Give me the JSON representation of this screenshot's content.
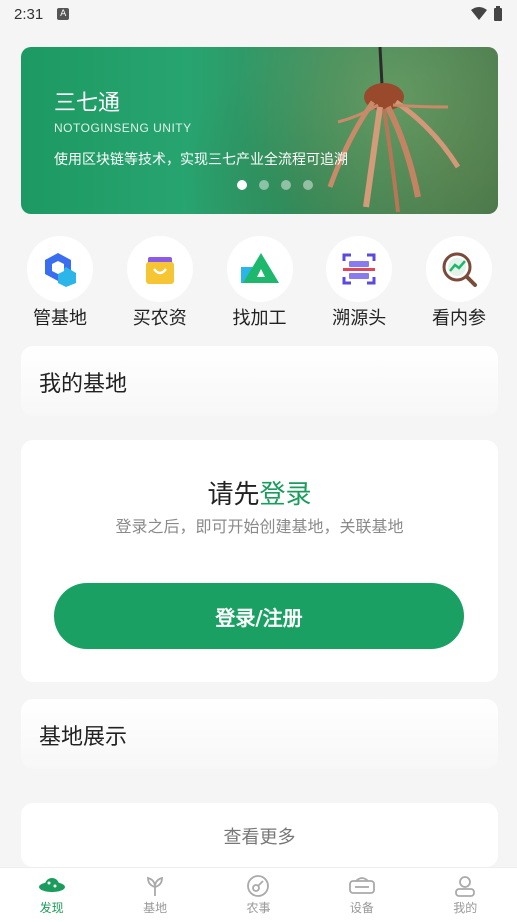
{
  "status_bar": {
    "time": "2:31",
    "notification": "A"
  },
  "banner": {
    "title": "三七通",
    "subtitle": "NOTOGINSENG UNITY",
    "description": "使用区块链等技术，实现三七产业全流程可追溯",
    "slide_count": 4,
    "active_slide": 1
  },
  "quick_menu": [
    {
      "label": "管基地",
      "icon": "hexagon-icon"
    },
    {
      "label": "买农资",
      "icon": "shopping-bag-icon"
    },
    {
      "label": "找加工",
      "icon": "triangle-icon"
    },
    {
      "label": "溯源头",
      "icon": "scan-icon"
    },
    {
      "label": "看内参",
      "icon": "chart-search-icon"
    }
  ],
  "my_base": {
    "title": "我的基地"
  },
  "login": {
    "prompt_prefix": "请先",
    "prompt_link": "登录",
    "hint": "登录之后，即可开始创建基地，关联基地",
    "button_label": "登录/注册"
  },
  "base_showcase": {
    "title": "基地展示"
  },
  "view_more": "查看更多",
  "tabs": [
    {
      "label": "发现",
      "icon": "planet-icon",
      "active": true
    },
    {
      "label": "基地",
      "icon": "sprout-icon",
      "active": false
    },
    {
      "label": "农事",
      "icon": "disc-icon",
      "active": false
    },
    {
      "label": "设备",
      "icon": "device-icon",
      "active": false
    },
    {
      "label": "我的",
      "icon": "user-icon",
      "active": false
    }
  ],
  "colors": {
    "accent": "#1aa062",
    "link": "#1a9c5c"
  }
}
